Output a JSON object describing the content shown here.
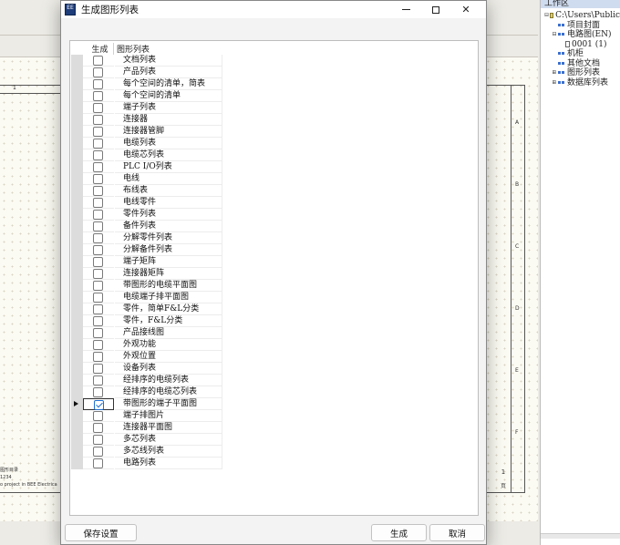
{
  "dialog": {
    "title": "生成图形列表",
    "app_icon_text": "EE",
    "columns": {
      "generate": "生成",
      "name": "图形列表"
    },
    "rows": [
      {
        "name": "文档列表",
        "checked": false
      },
      {
        "name": "产品列表",
        "checked": false
      },
      {
        "name": "每个空间的清单，简表",
        "checked": false
      },
      {
        "name": "每个空间的清单",
        "checked": false
      },
      {
        "name": "端子列表",
        "checked": false
      },
      {
        "name": "连接器",
        "checked": false
      },
      {
        "name": "连接器管脚",
        "checked": false
      },
      {
        "name": "电缆列表",
        "checked": false
      },
      {
        "name": "电缆芯列表",
        "checked": false
      },
      {
        "name": "PLC I/O列表",
        "checked": false
      },
      {
        "name": "电线",
        "checked": false
      },
      {
        "name": "布线表",
        "checked": false
      },
      {
        "name": "电线零件",
        "checked": false
      },
      {
        "name": "零件列表",
        "checked": false
      },
      {
        "name": "备件列表",
        "checked": false
      },
      {
        "name": "分解零件列表",
        "checked": false
      },
      {
        "name": "分解备件列表",
        "checked": false
      },
      {
        "name": "端子矩阵",
        "checked": false
      },
      {
        "name": "连接器矩阵",
        "checked": false
      },
      {
        "name": "带图形的电缆平面图",
        "checked": false
      },
      {
        "name": "电缆端子排平面图",
        "checked": false
      },
      {
        "name": "零件，简单F&L分类",
        "checked": false
      },
      {
        "name": "零件，F&L分类",
        "checked": false
      },
      {
        "name": "产品接线图",
        "checked": false
      },
      {
        "name": "外观功能",
        "checked": false
      },
      {
        "name": "外观位置",
        "checked": false
      },
      {
        "name": "设备列表",
        "checked": false
      },
      {
        "name": "经排序的电缆列表",
        "checked": false
      },
      {
        "name": "经排序的电缆芯列表",
        "checked": false
      },
      {
        "name": "带图形的端子平面图",
        "checked": true,
        "current": true
      },
      {
        "name": "端子排图片",
        "checked": false
      },
      {
        "name": "连接器平面图",
        "checked": false
      },
      {
        "name": "多芯列表",
        "checked": false
      },
      {
        "name": "多芯线列表",
        "checked": false
      },
      {
        "name": "电路列表",
        "checked": false
      }
    ],
    "buttons": {
      "save": "保存设置",
      "generate": "生成",
      "cancel": "取消"
    }
  },
  "workspace": {
    "title": "工作区",
    "tree": [
      {
        "label": "C:\\Users\\Public",
        "level": 0,
        "toggle": "⊟",
        "icon": "project-icon"
      },
      {
        "label": "项目封面",
        "level": 1,
        "toggle": "",
        "icon": "folder-icon"
      },
      {
        "label": "电路图(EN)",
        "level": 1,
        "toggle": "⊟",
        "icon": "folder-icon"
      },
      {
        "label": "0001  (1)",
        "level": 2,
        "toggle": "",
        "icon": "page-icon"
      },
      {
        "label": "机柜",
        "level": 1,
        "toggle": "",
        "icon": "folder-icon"
      },
      {
        "label": "其他文档",
        "level": 1,
        "toggle": "",
        "icon": "folder-icon"
      },
      {
        "label": "图形列表",
        "level": 1,
        "toggle": "⊞",
        "icon": "folder-icon"
      },
      {
        "label": "数据库列表",
        "level": 1,
        "toggle": "⊞",
        "icon": "folder-icon"
      }
    ]
  },
  "background": {
    "ruler_label": "1",
    "row_letters": [
      "A",
      "B",
      "C",
      "D",
      "E",
      "F"
    ],
    "title_block": [
      "图形目录",
      "1234",
      "o project in BEE Electrica"
    ],
    "sheet_number": "1",
    "sheet_sub": "页"
  }
}
